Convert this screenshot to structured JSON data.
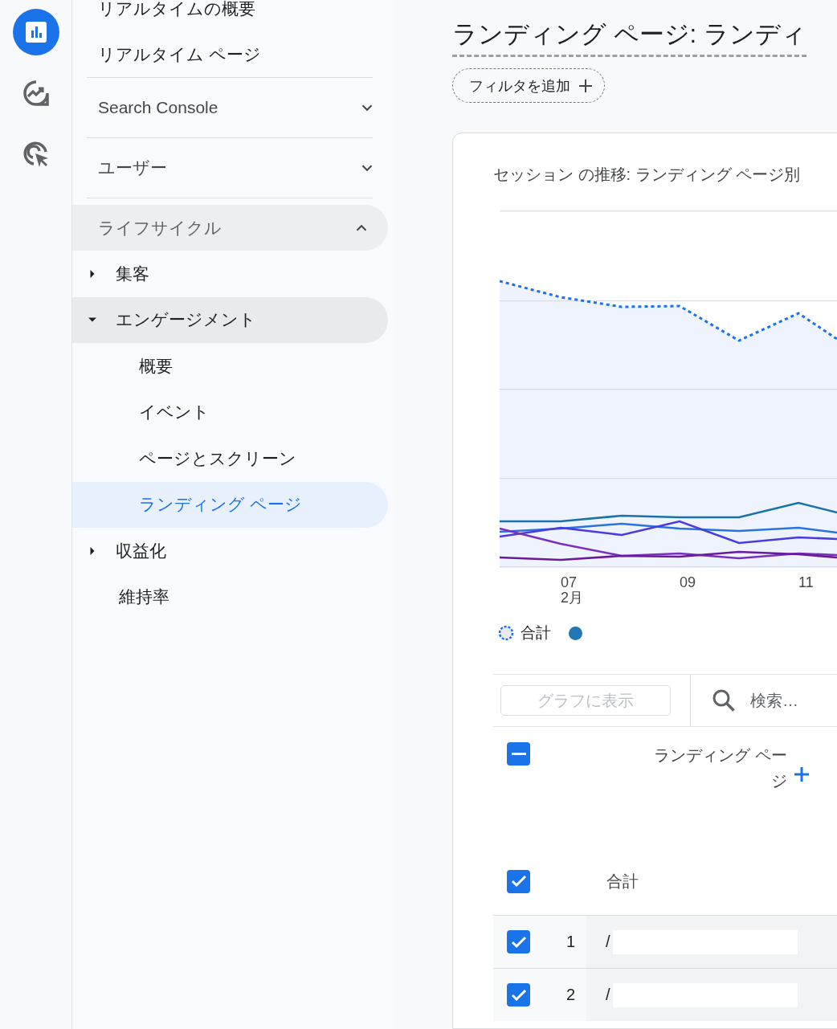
{
  "rail": [
    {
      "kind": "reports",
      "selected": true
    },
    {
      "kind": "explore",
      "selected": false
    },
    {
      "kind": "advertising",
      "selected": false
    }
  ],
  "sidebar": {
    "top_links": [
      "リアルタイムの概要",
      "リアルタイム ページ"
    ],
    "sections": [
      {
        "label": "Search Console",
        "expanded": false
      },
      {
        "label": "ユーザー",
        "expanded": false
      },
      {
        "label": "ライフサイクル",
        "expanded": true,
        "children": [
          {
            "kind": "group",
            "label": "集客",
            "expanded": false
          },
          {
            "kind": "group",
            "label": "エンゲージメント",
            "expanded": true,
            "children": [
              {
                "label": "概要",
                "selected": false
              },
              {
                "label": "イベント",
                "selected": false
              },
              {
                "label": "ページとスクリーン",
                "selected": false
              },
              {
                "label": "ランディング ページ",
                "selected": true
              }
            ]
          },
          {
            "kind": "group",
            "label": "収益化",
            "expanded": false
          },
          {
            "kind": "link",
            "label": "維持率"
          }
        ]
      }
    ]
  },
  "page": {
    "title": "ランディング ページ: ランディ",
    "filter_button": "フィルタを追加",
    "card": {
      "title": "セッション の推移: ランディング ページ別",
      "x_labels": [
        {
          "label": "07",
          "sub": "2月"
        },
        {
          "label": "09"
        },
        {
          "label": "11"
        }
      ],
      "legend": [
        {
          "kind": "total",
          "label": "合計"
        },
        {
          "kind": "dot",
          "color": "#1f77b4"
        }
      ],
      "table": {
        "plot_button": {
          "label": "グラフに表示",
          "disabled": true
        },
        "search": {
          "placeholder": "検索…"
        },
        "header": {
          "indeterminate": true,
          "column": "ランディング ページ"
        },
        "totals": {
          "checked": true,
          "label": "合計"
        },
        "rows": [
          {
            "checked": true,
            "index": "1",
            "landing_page": "/"
          },
          {
            "checked": true,
            "index": "2",
            "landing_page": "/"
          }
        ]
      }
    }
  }
}
